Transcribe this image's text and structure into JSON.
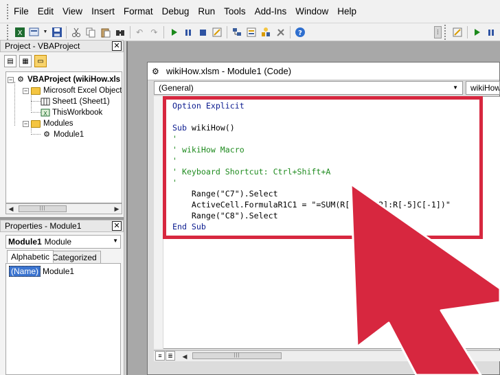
{
  "menubar": {
    "items": [
      "File",
      "Edit",
      "View",
      "Insert",
      "Format",
      "Debug",
      "Run",
      "Tools",
      "Add-Ins",
      "Window",
      "Help"
    ]
  },
  "project_pane": {
    "title": "Project - VBAProject",
    "tree": {
      "root": "VBAProject (wikiHow.xls",
      "group1": "Microsoft Excel Objects",
      "sheet1": "Sheet1 (Sheet1)",
      "workbook": "ThisWorkbook",
      "group2": "Modules",
      "module1": "Module1"
    }
  },
  "properties_pane": {
    "title": "Properties - Module1",
    "object_name": "Module1",
    "object_type": "Module",
    "tabs": [
      "Alphabetic",
      "Categorized"
    ],
    "row_name": "(Name)",
    "row_value": "Module1"
  },
  "code_window": {
    "title": "wikiHow.xlsm - Module1 (Code)",
    "object_combo": "(General)",
    "procedure_combo": "wikiHow",
    "lines": [
      {
        "kw": "Option Explicit",
        "rest": ""
      },
      {
        "kw": "",
        "rest": ""
      },
      {
        "kw": "Sub",
        "rest": " wikiHow()"
      },
      {
        "cm": "'"
      },
      {
        "cm": "' wikiHow Macro"
      },
      {
        "cm": "'"
      },
      {
        "cm": "' Keyboard Shortcut: Ctrl+Shift+A"
      },
      {
        "cm": "'"
      },
      {
        "tx": "    Range(\"C7\").Select"
      },
      {
        "tx": "    ActiveCell.FormulaR1C1 = \"=SUM(R[-5]C[-2]:R[-5]C[-1])\""
      },
      {
        "tx": "    Range(\"C8\").Select"
      },
      {
        "kw": "End Sub",
        "rest": ""
      }
    ]
  },
  "colors": {
    "highlight": "#d7273f",
    "keyword": "#0b1b8f",
    "comment": "#1f8b1f"
  }
}
